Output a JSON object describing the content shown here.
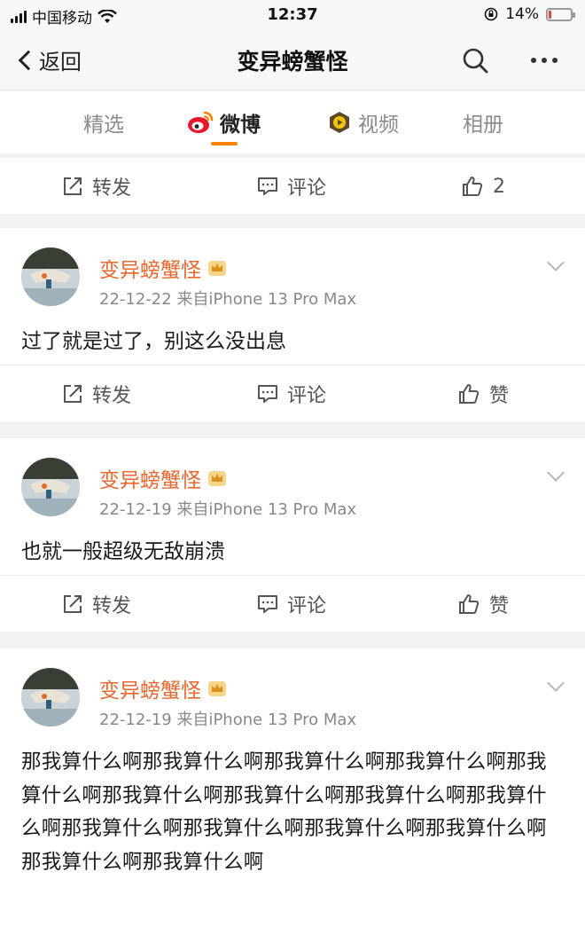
{
  "status_bar": {
    "carrier": "中国移动",
    "time": "12:37",
    "battery": "14%",
    "battery_level": 0.14,
    "battery_color": "#e0463a"
  },
  "nav": {
    "back_label": "返回",
    "title": "变异螃蟹怪",
    "icons": [
      "search-icon",
      "more-icon"
    ]
  },
  "tabs": [
    {
      "label": "精选",
      "active": false
    },
    {
      "label": "微博",
      "active": true,
      "icon": "weibo-logo-icon"
    },
    {
      "label": "视频",
      "active": false,
      "icon": "video-icon"
    },
    {
      "label": "相册",
      "active": false
    }
  ],
  "accent_color": "#ff8200",
  "top_actions": {
    "repost": "转发",
    "comment": "评论",
    "like": "2"
  },
  "posts": [
    {
      "author": "变异螃蟹怪",
      "date": "22-12-22",
      "source": "来自iPhone 13 Pro Max",
      "text": "过了就是过了，别这么没出息",
      "actions": {
        "repost": "转发",
        "comment": "评论",
        "like": "赞"
      }
    },
    {
      "author": "变异螃蟹怪",
      "date": "22-12-19",
      "source": "来自iPhone 13 Pro Max",
      "text": "也就一般超级无敌崩溃",
      "actions": {
        "repost": "转发",
        "comment": "评论",
        "like": "赞"
      }
    },
    {
      "author": "变异螃蟹怪",
      "date": "22-12-19",
      "source": "来自iPhone 13 Pro Max",
      "text": "那我算什么啊那我算什么啊那我算什么啊那我算什么啊那我算什么啊那我算什么啊那我算什么啊那我算什么啊那我算什么啊那我算什么啊那我算什么啊那我算什么啊那我算什么啊那我算什么啊那我算什么啊"
    }
  ]
}
